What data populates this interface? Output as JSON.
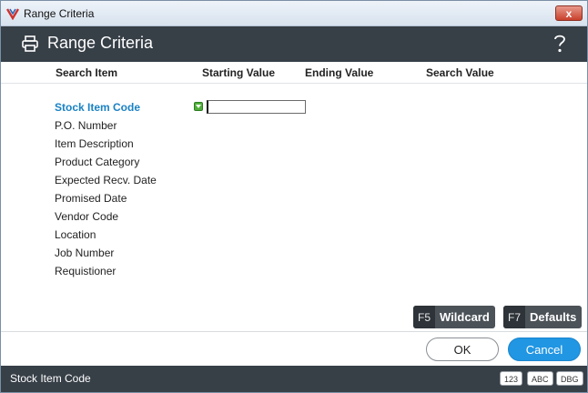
{
  "window": {
    "title": "Range Criteria",
    "close_label": "x"
  },
  "header": {
    "title": "Range Criteria"
  },
  "columns": {
    "search_item": "Search Item",
    "starting_value": "Starting Value",
    "ending_value": "Ending Value",
    "search_value": "Search Value"
  },
  "items": [
    "Stock Item Code",
    "P.O. Number",
    "Item Description",
    "Product Category",
    "Expected Recv. Date",
    "Promised Date",
    "Vendor Code",
    "Location",
    "Job Number",
    "Requistioner"
  ],
  "selected_item": "Stock Item Code",
  "starting_input": {
    "value": ""
  },
  "function_keys": [
    {
      "key": "F5",
      "label": "Wildcard"
    },
    {
      "key": "F7",
      "label": "Defaults"
    }
  ],
  "buttons": {
    "ok": "OK",
    "cancel": "Cancel"
  },
  "status": {
    "text": "Stock Item Code",
    "badges": [
      "123",
      "ABC",
      "DBG"
    ]
  },
  "colors": {
    "header_bg": "#373f47",
    "accent": "#1a82c4",
    "cancel_bg": "#2196e3"
  },
  "icons": {
    "app": "app-logo-icon",
    "header": "printer-icon",
    "help": "help-icon",
    "marker": "green-arrow-icon"
  }
}
